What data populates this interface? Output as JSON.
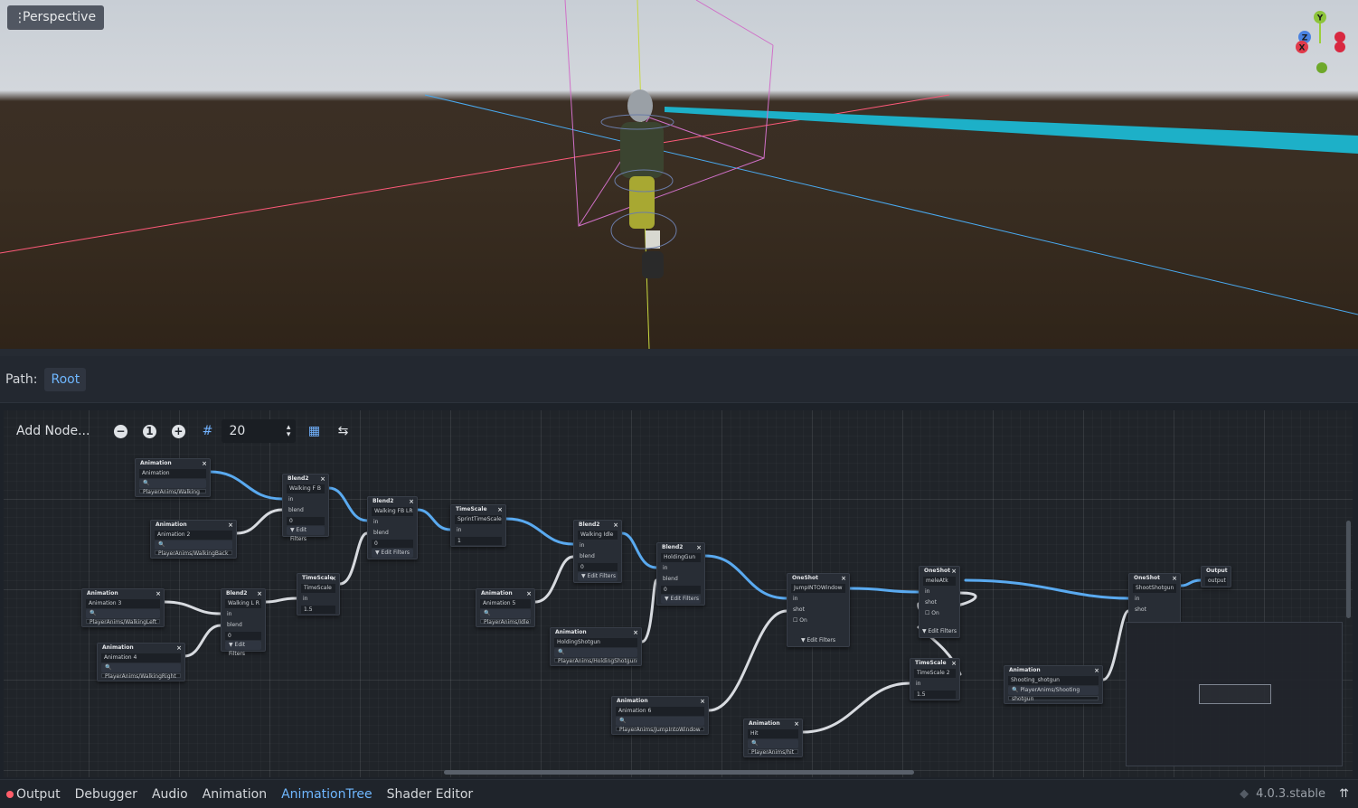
{
  "viewport": {
    "view_mode": "Perspective",
    "gizmo": {
      "y": "Y",
      "z": "Z",
      "x": "X"
    }
  },
  "path_bar": {
    "label": "Path:",
    "root": "Root"
  },
  "toolbar": {
    "add_node": "Add Node...",
    "snap_value": "20",
    "icons": [
      "zoom-out-icon",
      "zoom-reset-icon",
      "zoom-in-icon",
      "snap-grid-icon",
      "minimap-icon",
      "arrange-nodes-icon"
    ]
  },
  "nodes": [
    {
      "id": "anim1",
      "type": "Animation",
      "name": "Animation",
      "anim": "PlayerAnims/Walking"
    },
    {
      "id": "anim2",
      "type": "Animation",
      "name": "Animation 2",
      "anim": "PlayerAnims/WalkingBack"
    },
    {
      "id": "anim3",
      "type": "Animation",
      "name": "Animation 3",
      "anim": "PlayerAnims/WalkingLeft"
    },
    {
      "id": "anim4",
      "type": "Animation",
      "name": "Animation 4",
      "anim": "PlayerAnims/WalkingRight"
    },
    {
      "id": "anim5",
      "type": "Animation",
      "name": "Animation 5",
      "anim": "PlayerAnims/Idle"
    },
    {
      "id": "anim6",
      "type": "Animation",
      "name": "Animation 6",
      "anim": "PlayerAnims/JumpIntoWindow"
    },
    {
      "id": "animHolding",
      "type": "Animation",
      "name": "HoldingShotgun",
      "anim": "PlayerAnims/HoldingShotgun"
    },
    {
      "id": "animHit",
      "type": "Animation",
      "name": "Hit",
      "anim": "PlayerAnims/hit"
    },
    {
      "id": "animShoot",
      "type": "Animation",
      "name": "Shooting_shotgun",
      "anim": "PlayerAnims/Shooting shotgun"
    },
    {
      "id": "blendFB",
      "type": "Blend2",
      "name": "Walking F B",
      "in": "in",
      "blend": "blend",
      "value": "0",
      "filters": "Edit Filters"
    },
    {
      "id": "blendLR",
      "type": "Blend2",
      "name": "Walking L R",
      "in": "in",
      "blend": "blend",
      "value": "0",
      "filters": "Edit Filters"
    },
    {
      "id": "blendFBLR",
      "type": "Blend2",
      "name": "Walking FB LR",
      "in": "in",
      "blend": "blend",
      "value": "0",
      "filters": "Edit Filters"
    },
    {
      "id": "blendIdle",
      "type": "Blend2",
      "name": "Walking Idle",
      "in": "in",
      "blend": "blend",
      "value": "0",
      "filters": "Edit Filters"
    },
    {
      "id": "blendGun",
      "type": "Blend2",
      "name": "HoldingGun",
      "in": "in",
      "blend": "blend",
      "value": "0",
      "filters": "Edit Filters"
    },
    {
      "id": "tsSprint",
      "type": "TimeScale",
      "name": "SprintTimeScale",
      "in": "in",
      "value": "1"
    },
    {
      "id": "tsMain",
      "type": "TimeScale",
      "name": "TimeScale",
      "in": "in",
      "value": "1.5"
    },
    {
      "id": "ts2",
      "type": "TimeScale",
      "name": "TimeScale 2",
      "in": "in",
      "value": "1.5"
    },
    {
      "id": "osJump",
      "type": "OneShot",
      "name": "JumpINTOWindow",
      "in": "in",
      "shot": "shot",
      "on": "On",
      "filters": "Edit Filters"
    },
    {
      "id": "osMelee",
      "type": "OneShot",
      "name": "meleAtk",
      "in": "in",
      "shot": "shot",
      "on": "On",
      "filters": "Edit Filters"
    },
    {
      "id": "osShoot",
      "type": "OneShot",
      "name": "ShootShotgun",
      "in": "in",
      "shot": "shot"
    },
    {
      "id": "output",
      "type": "Output",
      "name": "output"
    }
  ],
  "bottom_tabs": [
    "Output",
    "Debugger",
    "Audio",
    "Animation",
    "AnimationTree",
    "Shader Editor"
  ],
  "active_tab": "AnimationTree",
  "version": "4.0.3.stable",
  "colors": {
    "accent": "#6fb7ff",
    "error_dot": "#ff5d6a",
    "wire_blue": "#5aaaf0",
    "wire_white": "#d8dbe0"
  }
}
